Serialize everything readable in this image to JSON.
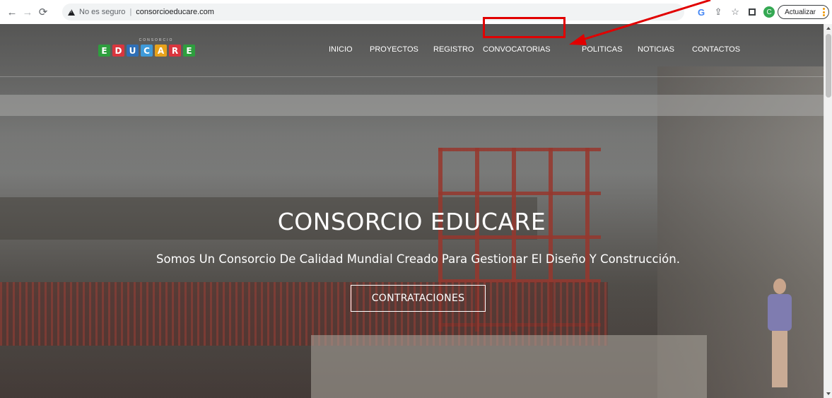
{
  "browser": {
    "security_label": "No es seguro",
    "separator": "|",
    "url": "consorcioeducare.com",
    "profile_initial": "C",
    "update_button": "Actualizar",
    "icons": [
      "back-arrow-icon",
      "forward-arrow-icon",
      "reload-icon",
      "warning-icon",
      "google-icon",
      "share-icon",
      "star-icon",
      "side-panel-icon",
      "kebab-menu-icon"
    ]
  },
  "site": {
    "logo": {
      "top_text": "CONSORCIO",
      "letters": [
        "E",
        "D",
        "U",
        "C",
        "A",
        "R",
        "E"
      ],
      "colors": [
        "#2e9e3e",
        "#d9363e",
        "#2f6fb6",
        "#3e9ad9",
        "#e7a21b",
        "#d9363e",
        "#2e9e3e"
      ]
    },
    "menu": [
      "INICIO",
      "PROYECTOS",
      "REGISTRO",
      "CONVOCATORIAS",
      "POLITICAS",
      "NOTICIAS",
      "CONTACTOS"
    ],
    "highlighted_item": "CONVOCATORIAS",
    "hero": {
      "title": "CONSORCIO EDUCARE",
      "subtitle": "Somos Un Consorcio De Calidad Mundial Creado Para Gestionar El Diseño Y Construcción.",
      "cta_label": "CONTRATACIONES"
    }
  },
  "annotation": {
    "color": "#e10000"
  }
}
